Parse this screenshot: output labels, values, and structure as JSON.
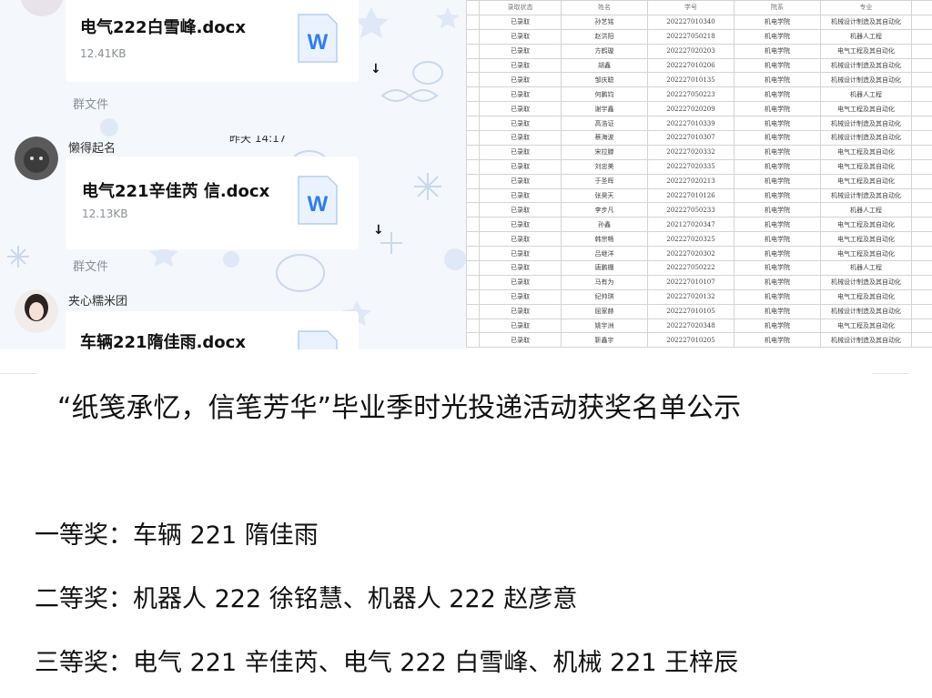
{
  "chat": {
    "messages": [
      {
        "sender": "",
        "file_name": "电气222白雪峰.docx",
        "file_size": "12.41KB",
        "group_label": "群文件",
        "icon": "word-doc-icon"
      },
      {
        "sender": "懒得起名",
        "file_name": "电气221辛佳芮 信.docx",
        "file_size": "12.13KB",
        "group_label": "群文件",
        "icon": "word-doc-icon",
        "partial_time": "昨天 14:17"
      },
      {
        "sender": "夹心糯米团",
        "file_name": "车辆221隋佳雨.docx",
        "file_size": "",
        "icon": "word-doc-icon"
      }
    ],
    "word_icon_letter": "W",
    "colors": {
      "word_blue": "#2f7cf6",
      "background": "#f4f7fc"
    }
  },
  "sheet": {
    "headers": [
      "录取状态",
      "姓名",
      "学号",
      "院系",
      "专业"
    ],
    "rows": [
      [
        "已录取",
        "孙艺铭",
        "202227010340",
        "机电学院",
        "机械设计制造及其自动化"
      ],
      [
        "已录取",
        "赵洪阳",
        "202227050218",
        "机电学院",
        "机器人工程"
      ],
      [
        "已录取",
        "方鹤璇",
        "202227020203",
        "机电学院",
        "电气工程及其自动化"
      ],
      [
        "已录取",
        "胡鑫",
        "202227010206",
        "机电学院",
        "机械设计制造及其自动化"
      ],
      [
        "已录取",
        "邹庆聪",
        "202227010135",
        "机电学院",
        "机械设计制造及其自动化"
      ],
      [
        "已录取",
        "何鹏钧",
        "202227050223",
        "机电学院",
        "机器人工程"
      ],
      [
        "已录取",
        "谢宇鑫",
        "202227020209",
        "机电学院",
        "电气工程及其自动化"
      ],
      [
        "已录取",
        "高浩证",
        "202227010339",
        "机电学院",
        "机械设计制造及其自动化"
      ],
      [
        "已录取",
        "蔡海波",
        "202227010307",
        "机电学院",
        "机械设计制造及其自动化"
      ],
      [
        "已录取",
        "宋拉滕",
        "202227020332",
        "机电学院",
        "电气工程及其自动化"
      ],
      [
        "已录取",
        "刘忠美",
        "202227020335",
        "机电学院",
        "电气工程及其自动化"
      ],
      [
        "已录取",
        "于圣晖",
        "202227020213",
        "机电学院",
        "电气工程及其自动化"
      ],
      [
        "已录取",
        "张昊天",
        "202227010126",
        "机电学院",
        "机械设计制造及其自动化"
      ],
      [
        "已录取",
        "李步凡",
        "202227050233",
        "机电学院",
        "机器人工程"
      ],
      [
        "已录取",
        "孙鑫",
        "202127020347",
        "机电学院",
        "电气工程及其自动化"
      ],
      [
        "已录取",
        "韩宗畅",
        "202227020325",
        "机电学院",
        "电气工程及其自动化"
      ],
      [
        "已录取",
        "吕继洋",
        "202227020302",
        "机电学院",
        "电气工程及其自动化"
      ],
      [
        "已录取",
        "唐鹏棚",
        "202227050222",
        "机电学院",
        "机器人工程"
      ],
      [
        "已录取",
        "马有为",
        "202227010107",
        "机电学院",
        "机械设计制造及其自动化"
      ],
      [
        "已录取",
        "纪帅琪",
        "202227020132",
        "机电学院",
        "电气工程及其自动化"
      ],
      [
        "已录取",
        "屈家赫",
        "202227010105",
        "机电学院",
        "机械设计制造及其自动化"
      ],
      [
        "已录取",
        "姚宇洲",
        "202227020348",
        "机电学院",
        "电气工程及其自动化"
      ],
      [
        "已录取",
        "靳鑫宇",
        "202227010205",
        "机电学院",
        "机械设计制造及其自动化"
      ]
    ]
  },
  "notice": {
    "title": "“纸笺承忆，信笔芳华”毕业季时光投递活动获奖名单公示",
    "prizes": [
      "一等奖：车辆 221 隋佳雨",
      "二等奖：机器人 222 徐铭慧、机器人 222 赵彦意",
      "三等奖：电气 221 辛佳芮、电气 222 白雪峰、机械 221 王梓辰"
    ]
  }
}
